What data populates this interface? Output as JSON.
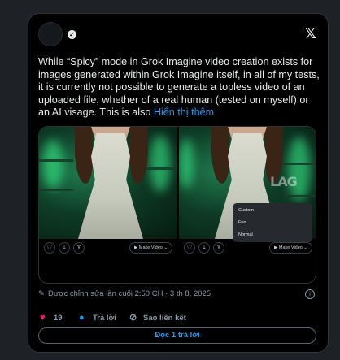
{
  "tweet": {
    "text": "While “Spicy” mode in Grok Imagine video creation exists for images generated within Grok Imagine itself, in all of my tests, it is currently not possible to generate a topless video of an uploaded file, whether of a real human (tested on myself) or an AI visage.  This is also ",
    "show_more": "Hiển thị thêm",
    "edited_label": "Được chỉnh sửa lần cuối 2:50 CH · 3 th 8, 2025"
  },
  "media": {
    "left": {
      "make_video_label": "Make Video"
    },
    "right": {
      "make_video_label": "Make Video",
      "menu_items": [
        "Custom",
        "Fun",
        "Normal"
      ]
    },
    "watermark": "LAG"
  },
  "actions": {
    "like_count": "19",
    "reply_label": "Trả lời",
    "copy_link_label": "Sao liên kết"
  },
  "read_replies_label": "Đọc 1 trả lời",
  "colors": {
    "accent": "#1d9bf0",
    "like": "#f91880",
    "background": "#000000",
    "muted_text": "#8b98a5"
  },
  "icons": [
    "verified-badge-icon",
    "x-logo-icon",
    "pencil-icon",
    "info-icon",
    "heart-icon",
    "reply-bubble-icon",
    "link-icon",
    "heart-small-icon",
    "download-icon",
    "share-icon",
    "video-icon",
    "chevron-down-icon"
  ]
}
